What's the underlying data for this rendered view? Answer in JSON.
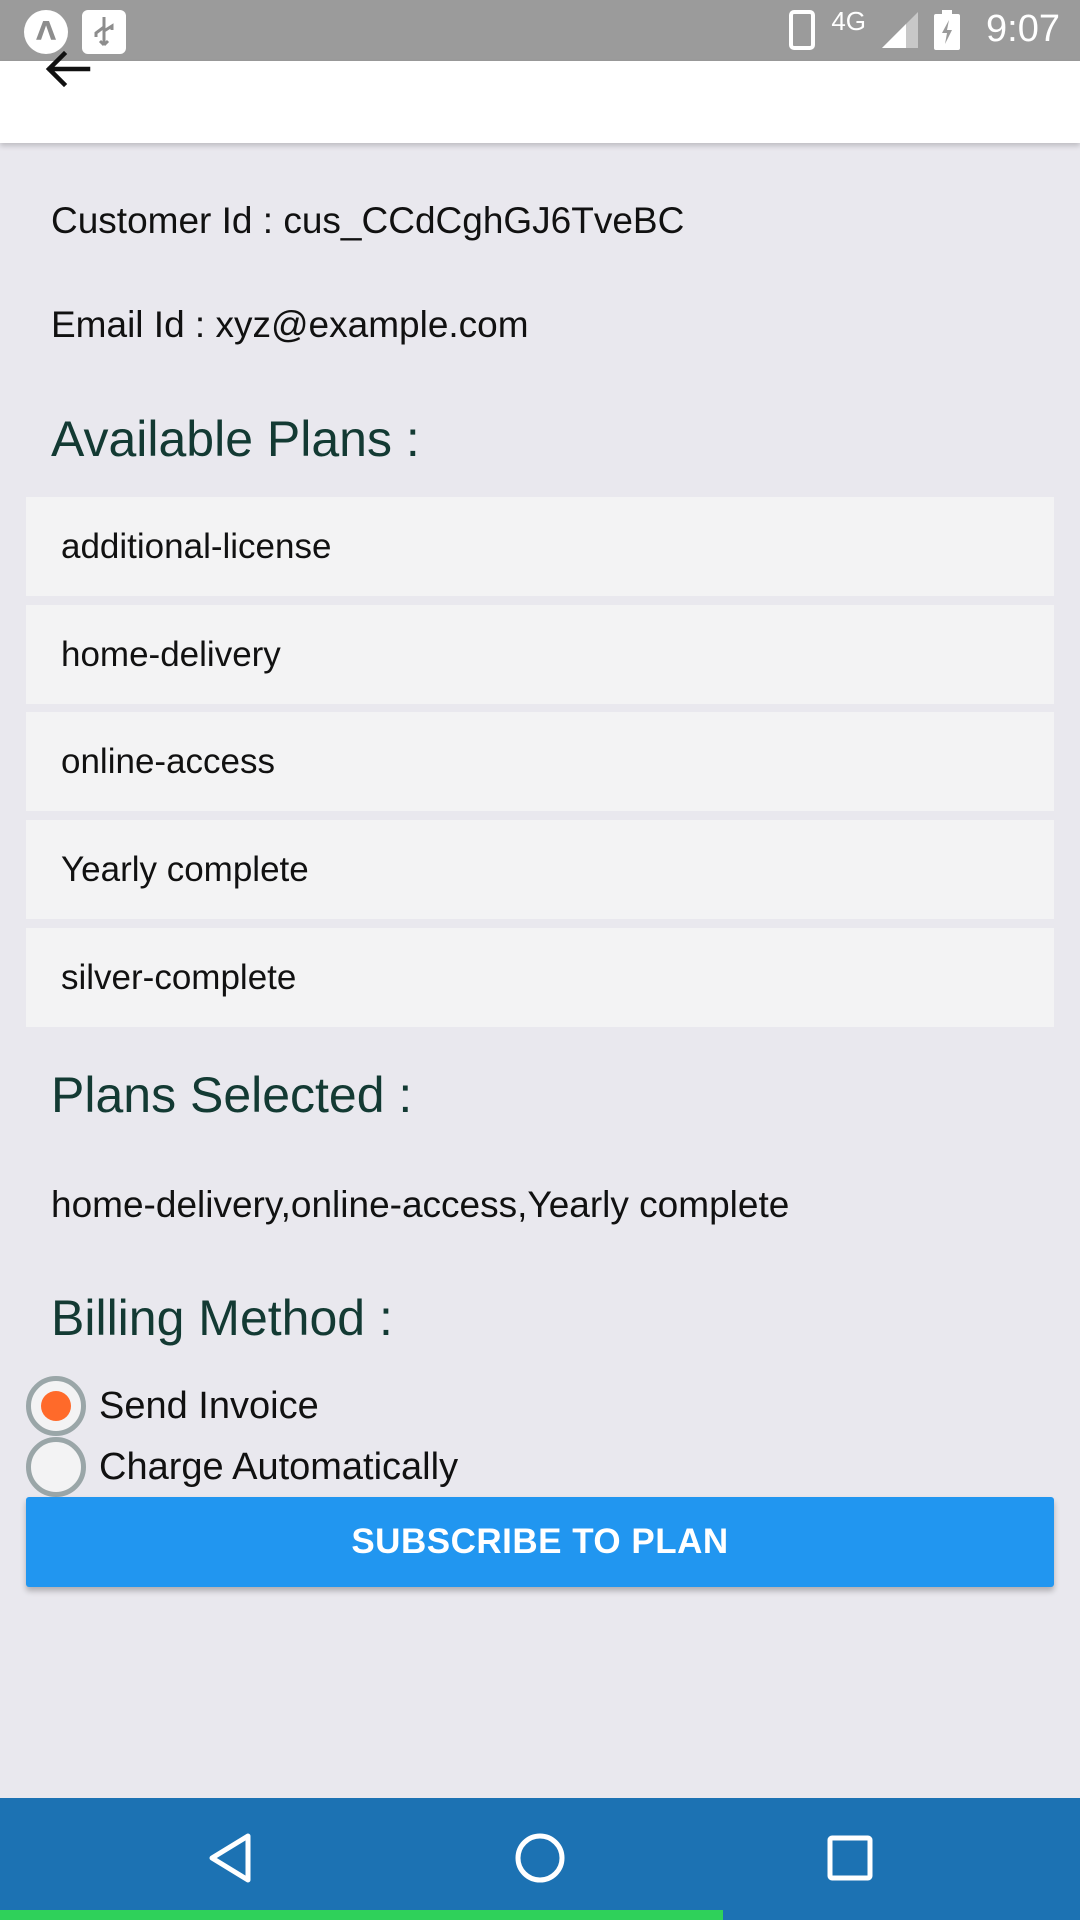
{
  "status_bar": {
    "time": "9:07",
    "network": "4G",
    "left_icons": [
      "notification-app-icon",
      "usb-icon"
    ],
    "right_icons": [
      "phone-icon",
      "signal-icon",
      "battery-charging-icon"
    ]
  },
  "app_bar": {
    "back_icon": "arrow-left-icon"
  },
  "customer": {
    "customer_id_line": "Customer Id : cus_CCdCghGJ6TveBC",
    "email_line": "Email Id : xyz@example.com"
  },
  "available_plans": {
    "title": "Available Plans :",
    "items": [
      {
        "label": "additional-license"
      },
      {
        "label": "home-delivery"
      },
      {
        "label": "online-access"
      },
      {
        "label": "Yearly complete"
      },
      {
        "label": "silver-complete"
      }
    ]
  },
  "plans_selected": {
    "title": "Plans Selected :",
    "value": "home-delivery,online-access,Yearly complete"
  },
  "billing": {
    "title": "Billing Method :",
    "options": [
      {
        "label": "Send Invoice",
        "selected": true
      },
      {
        "label": "Charge Automatically",
        "selected": false
      }
    ],
    "accent_color": "#ff6a2a"
  },
  "subscribe_button": {
    "label": "SUBSCRIBE TO PLAN",
    "color": "#2196f0"
  },
  "nav_bar": {
    "buttons": [
      "back-triangle-icon",
      "home-circle-icon",
      "recents-square-icon"
    ],
    "color": "#1c72b3"
  }
}
